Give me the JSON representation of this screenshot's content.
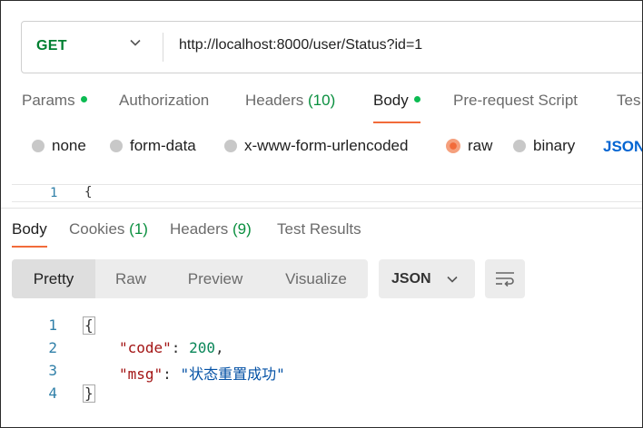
{
  "request": {
    "method": "GET",
    "url": "http://localhost:8000/user/Status?id=1"
  },
  "request_tabs": [
    {
      "label": "Params",
      "dot": true
    },
    {
      "label": "Authorization"
    },
    {
      "label": "Headers",
      "count": "(10)"
    },
    {
      "label": "Body",
      "dot": true,
      "active": true
    },
    {
      "label": "Pre-request Script"
    },
    {
      "label": "Tes"
    }
  ],
  "body_types": [
    {
      "label": "none",
      "checked": false
    },
    {
      "label": "form-data",
      "checked": false
    },
    {
      "label": "x-www-form-urlencoded",
      "checked": false
    },
    {
      "label": "raw",
      "checked": true
    },
    {
      "label": "binary",
      "checked": false
    }
  ],
  "body_language": "JSON",
  "request_editor": {
    "line": "1",
    "text": "{"
  },
  "response_tabs": [
    {
      "label": "Body",
      "active": true
    },
    {
      "label": "Cookies",
      "count": "(1)"
    },
    {
      "label": "Headers",
      "count": "(9)"
    },
    {
      "label": "Test Results"
    }
  ],
  "view_modes": [
    "Pretty",
    "Raw",
    "Preview",
    "Visualize"
  ],
  "active_view": "Pretty",
  "response_format": "JSON",
  "response_lines": [
    {
      "n": "1",
      "open": "{"
    },
    {
      "n": "2",
      "key": "\"code\"",
      "sep": ": ",
      "num": "200",
      "tail": ","
    },
    {
      "n": "3",
      "key": "\"msg\"",
      "sep": ": ",
      "str": "\"状态重置成功\""
    },
    {
      "n": "4",
      "close": "}"
    }
  ],
  "colors": {
    "accent": "#f26b3a",
    "method_get": "#007f31",
    "link": "#0265d2",
    "count_green": "#0a8f3f"
  }
}
